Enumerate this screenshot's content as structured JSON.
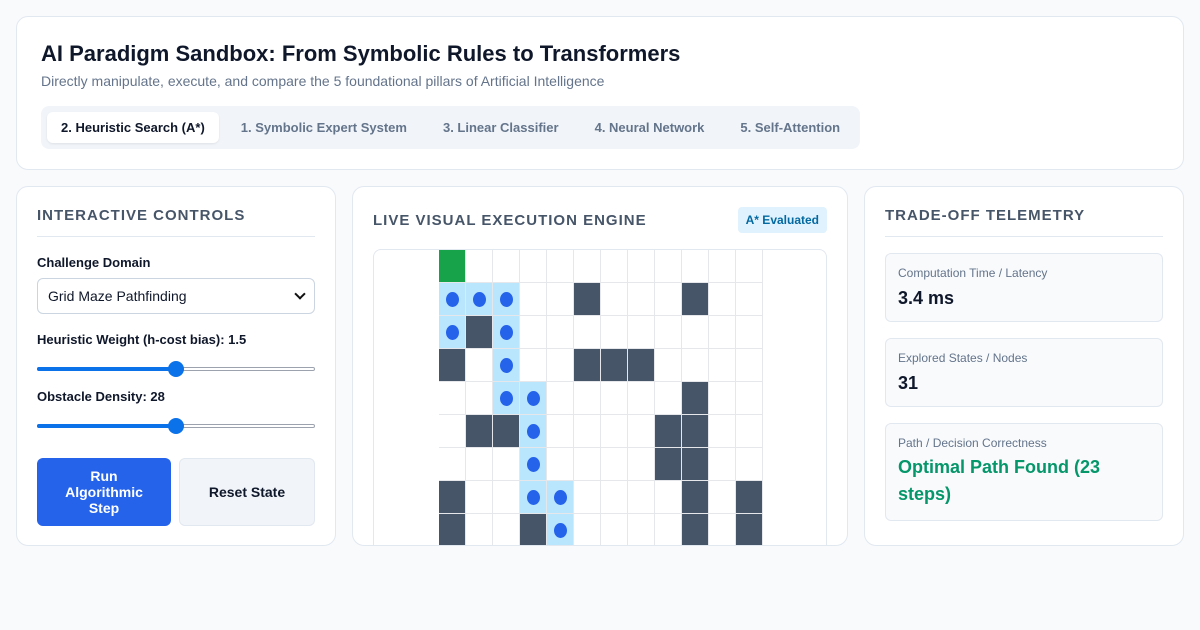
{
  "header": {
    "title": "AI Paradigm Sandbox: From Symbolic Rules to Transformers",
    "subtitle": "Directly manipulate, execute, and compare the 5 foundational pillars of Artificial Intelligence"
  },
  "tabs": [
    {
      "label": "2. Heuristic Search (A*)",
      "active": true
    },
    {
      "label": "1. Symbolic Expert System",
      "active": false
    },
    {
      "label": "3. Linear Classifier",
      "active": false
    },
    {
      "label": "4. Neural Network",
      "active": false
    },
    {
      "label": "5. Self-Attention",
      "active": false
    }
  ],
  "controls": {
    "title": "Interactive Controls",
    "domain_label": "Challenge Domain",
    "domain_value": "Grid Maze Pathfinding",
    "heuristic_label": "Heuristic Weight (h-cost bias): 1.5",
    "heuristic_level": 0.5,
    "density_label": "Obstacle Density: 28",
    "density_level": 0.5,
    "run_label": "Run Algorithmic Step",
    "reset_label": "Reset State"
  },
  "engine": {
    "title": "Live Visual Execution Engine",
    "badge": "A* Evaluated",
    "grid_rows": [
      "S...........",
      "PPP..#...#..",
      "P#P.........",
      "#.P..###....",
      "..PP.....#..",
      ".##P....##..",
      "...P....##..",
      "#..PP....#.#",
      "#..#P....#.#"
    ]
  },
  "telemetry": {
    "title": "Trade-off Telemetry",
    "latency_label": "Computation Time / Latency",
    "latency_value": "3.4 ms",
    "explored_label": "Explored States / Nodes",
    "explored_value": "31",
    "correct_label": "Path / Decision Correctness",
    "correct_value": "Optimal Path Found (23 steps)",
    "success_color": "#059669"
  }
}
